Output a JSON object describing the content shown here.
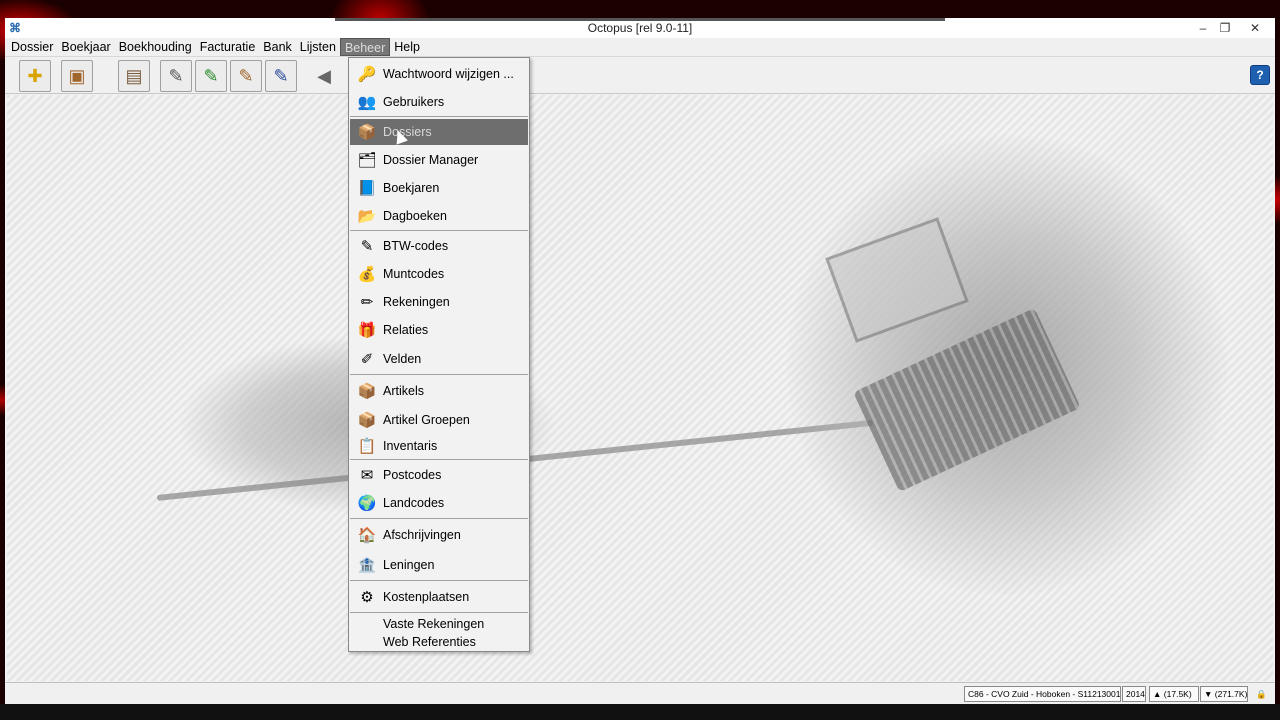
{
  "window": {
    "title": "Octopus [rel 9.0-11]",
    "minimize": "–",
    "restore": "❐",
    "close": "✕",
    "app_icon": "⌘"
  },
  "menubar": [
    "Dossier",
    "Boekjaar",
    "Boekhouding",
    "Facturatie",
    "Bank",
    "Lijsten",
    "Beheer",
    "Help"
  ],
  "active_menu": "Beheer",
  "toolbar": {
    "buttons": [
      {
        "name": "new-dossier-icon",
        "glyph": "✚"
      },
      {
        "name": "open-dossier-icon",
        "glyph": "▣"
      },
      {
        "name": "book-icon",
        "glyph": "▤"
      },
      {
        "name": "booking-icon-1",
        "glyph": "✎"
      },
      {
        "name": "booking-icon-2",
        "glyph": "✎"
      },
      {
        "name": "booking-icon-3",
        "glyph": "✎"
      },
      {
        "name": "booking-icon-4",
        "glyph": "✎"
      },
      {
        "name": "back-arrow-icon",
        "glyph": "◀"
      }
    ],
    "help_label": "?"
  },
  "beheer_menu": {
    "items": [
      {
        "label": "Wachtwoord wijzigen ...",
        "icon": "🔑"
      },
      {
        "label": "Gebruikers",
        "icon": "👥"
      },
      {
        "label": "Dossiers",
        "icon": "📦"
      },
      {
        "label": "Dossier Manager",
        "icon": "🗂"
      },
      {
        "label": "Boekjaren",
        "icon": "📘"
      },
      {
        "label": "Dagboeken",
        "icon": "📂"
      },
      {
        "label": "BTW-codes",
        "icon": "✎"
      },
      {
        "label": "Muntcodes",
        "icon": "💰"
      },
      {
        "label": "Rekeningen",
        "icon": "✏"
      },
      {
        "label": "Relaties",
        "icon": "🎁"
      },
      {
        "label": "Velden",
        "icon": "✐"
      },
      {
        "label": "Artikels",
        "icon": "📦"
      },
      {
        "label": "Artikel Groepen",
        "icon": "📦"
      },
      {
        "label": "Inventaris",
        "icon": "📋"
      },
      {
        "label": "Postcodes",
        "icon": "✉"
      },
      {
        "label": "Landcodes",
        "icon": "🌍"
      },
      {
        "label": "Afschrijvingen",
        "icon": "🏠"
      },
      {
        "label": "Leningen",
        "icon": "🏦"
      },
      {
        "label": "Kostenplaatsen",
        "icon": "⚙"
      },
      {
        "label": "Vaste Rekeningen",
        "icon": ""
      },
      {
        "label": "Web Referenties",
        "icon": ""
      }
    ],
    "highlighted": "Dossiers"
  },
  "statusbar": {
    "company": "C86 - CVO Zuid - Hoboken - S11213001",
    "year": "2014",
    "up": "(17.5K)",
    "down": "(271.7K)",
    "up_icon": "▲",
    "down_icon": "▼",
    "lock_icon": "🔒"
  }
}
